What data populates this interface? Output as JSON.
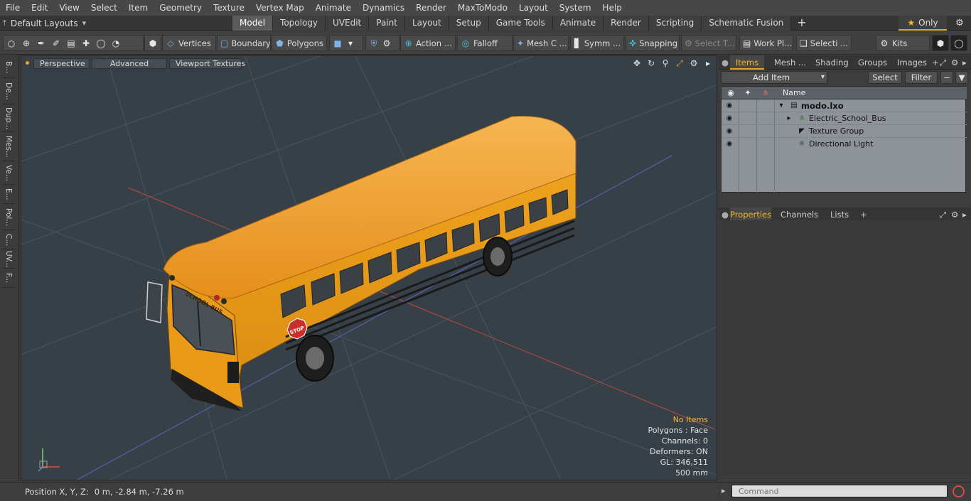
{
  "menubar": [
    "File",
    "Edit",
    "View",
    "Select",
    "Item",
    "Geometry",
    "Texture",
    "Vertex Map",
    "Animate",
    "Dynamics",
    "Render",
    "MaxToModo",
    "Layout",
    "System",
    "Help"
  ],
  "tabbar": {
    "layouts_label": "Default Layouts",
    "tabs": [
      {
        "label": "Model",
        "active": true
      },
      {
        "label": "Topology",
        "active": false
      },
      {
        "label": "UVEdit",
        "active": false
      },
      {
        "label": "Paint",
        "active": false
      },
      {
        "label": "Layout",
        "active": false
      },
      {
        "label": "Setup",
        "active": false
      },
      {
        "label": "Game Tools",
        "active": false
      },
      {
        "label": "Animate",
        "active": false
      },
      {
        "label": "Render",
        "active": false
      },
      {
        "label": "Scripting",
        "active": false
      },
      {
        "label": "Schematic Fusion",
        "active": false
      }
    ],
    "add_tab": "+",
    "only_label": "Only"
  },
  "toolbar": {
    "vertices": "Vertices",
    "boundary": "Boundary",
    "polygons": "Polygons",
    "action": "Action",
    "falloff": "Falloff",
    "mesh": "Mesh C ...",
    "symmetry": "Symm ...",
    "snapping": "Snapping",
    "select_t": "Select T...",
    "work_plane": "Work Pl...",
    "selection": "Selecti ...",
    "kits": "Kits"
  },
  "lefttabs": [
    "B...",
    "De...",
    "Dup...",
    "Mes...",
    "Ve...",
    "E...",
    "Pol...",
    "C...",
    "UV...",
    "F..."
  ],
  "viewport": {
    "perspective": "Perspective",
    "advanced": "Advanced",
    "viewport_textures": "Viewport Textures",
    "bus_text": "SCHOOL BUS",
    "stop_text": "STOP",
    "info": {
      "no_items": "No Items",
      "polygons": "Polygons : Face",
      "channels": "Channels: 0",
      "deformers": "Deformers: ON",
      "gl": "GL: 346,511",
      "scale": "500 mm"
    }
  },
  "statusbar": {
    "label": "Position X, Y, Z:",
    "value": "0 m, -2.84 m, -7.26 m"
  },
  "items_panel": {
    "tabs": [
      "Items",
      "Mesh ...",
      "Shading",
      "Groups",
      "Images"
    ],
    "add_item": "Add Item",
    "select": "Select",
    "filter": "Filter",
    "name_header": "Name",
    "rows": [
      "modo.lxo",
      "Electric_School_Bus",
      "Texture Group",
      "Directional Light"
    ]
  },
  "props_panel": {
    "tabs": [
      "Properties",
      "Channels",
      "Lists"
    ],
    "add": "+"
  },
  "command": {
    "placeholder": "Command"
  },
  "colors": {
    "accent": "#e0a32b",
    "bus_yellow": "#f3a21c",
    "viewport_bg": "#384047"
  }
}
